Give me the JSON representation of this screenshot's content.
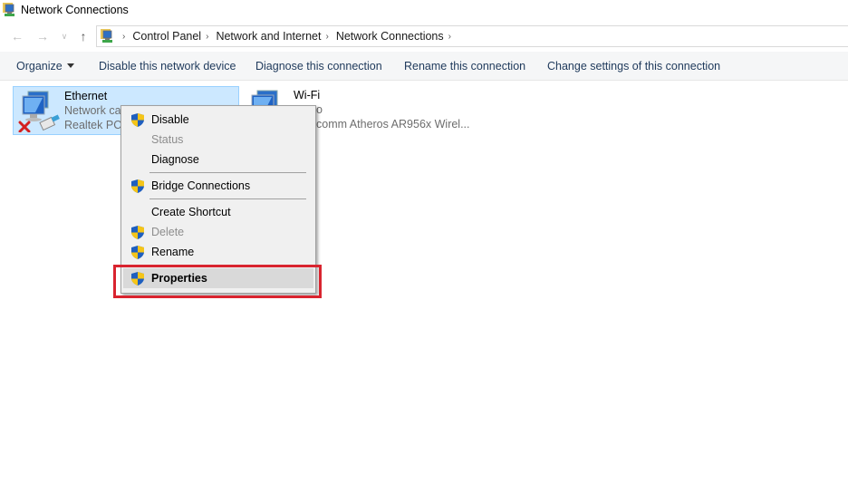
{
  "window": {
    "title": "Network Connections",
    "icon": "network-connections-icon"
  },
  "navigation": {
    "back_icon": "arrow-left-icon",
    "forward_icon": "arrow-right-icon",
    "recent_icon": "chevron-down-icon",
    "up_icon": "arrow-up-icon",
    "breadcrumbs": [
      "Control Panel",
      "Network and Internet",
      "Network Connections"
    ]
  },
  "commandbar": {
    "organize": "Organize",
    "commands": [
      "Disable this network device",
      "Diagnose this connection",
      "Rename this connection",
      "Change settings of this connection"
    ]
  },
  "connections": [
    {
      "name": "Ethernet",
      "status": "Network ca",
      "device": "Realtek PCIe",
      "selected": true,
      "state_icon": "disconnected-x-icon"
    },
    {
      "name": "Wi-Fi",
      "status": "o",
      "device": "comm Atheros AR956x Wirel...",
      "selected": false
    }
  ],
  "context_menu": {
    "items": [
      {
        "label": "Disable",
        "shield": true,
        "disabled": false
      },
      {
        "label": "Status",
        "shield": false,
        "disabled": true
      },
      {
        "label": "Diagnose",
        "shield": false,
        "disabled": false
      },
      {
        "label": "Bridge Connections",
        "shield": true,
        "disabled": false
      },
      {
        "label": "Create Shortcut",
        "shield": false,
        "disabled": false
      },
      {
        "label": "Delete",
        "shield": true,
        "disabled": true
      },
      {
        "label": "Rename",
        "shield": true,
        "disabled": false
      },
      {
        "label": "Properties",
        "shield": true,
        "disabled": false,
        "default": true,
        "highlighted": true
      }
    ],
    "annotation_color": "#d9242f"
  }
}
